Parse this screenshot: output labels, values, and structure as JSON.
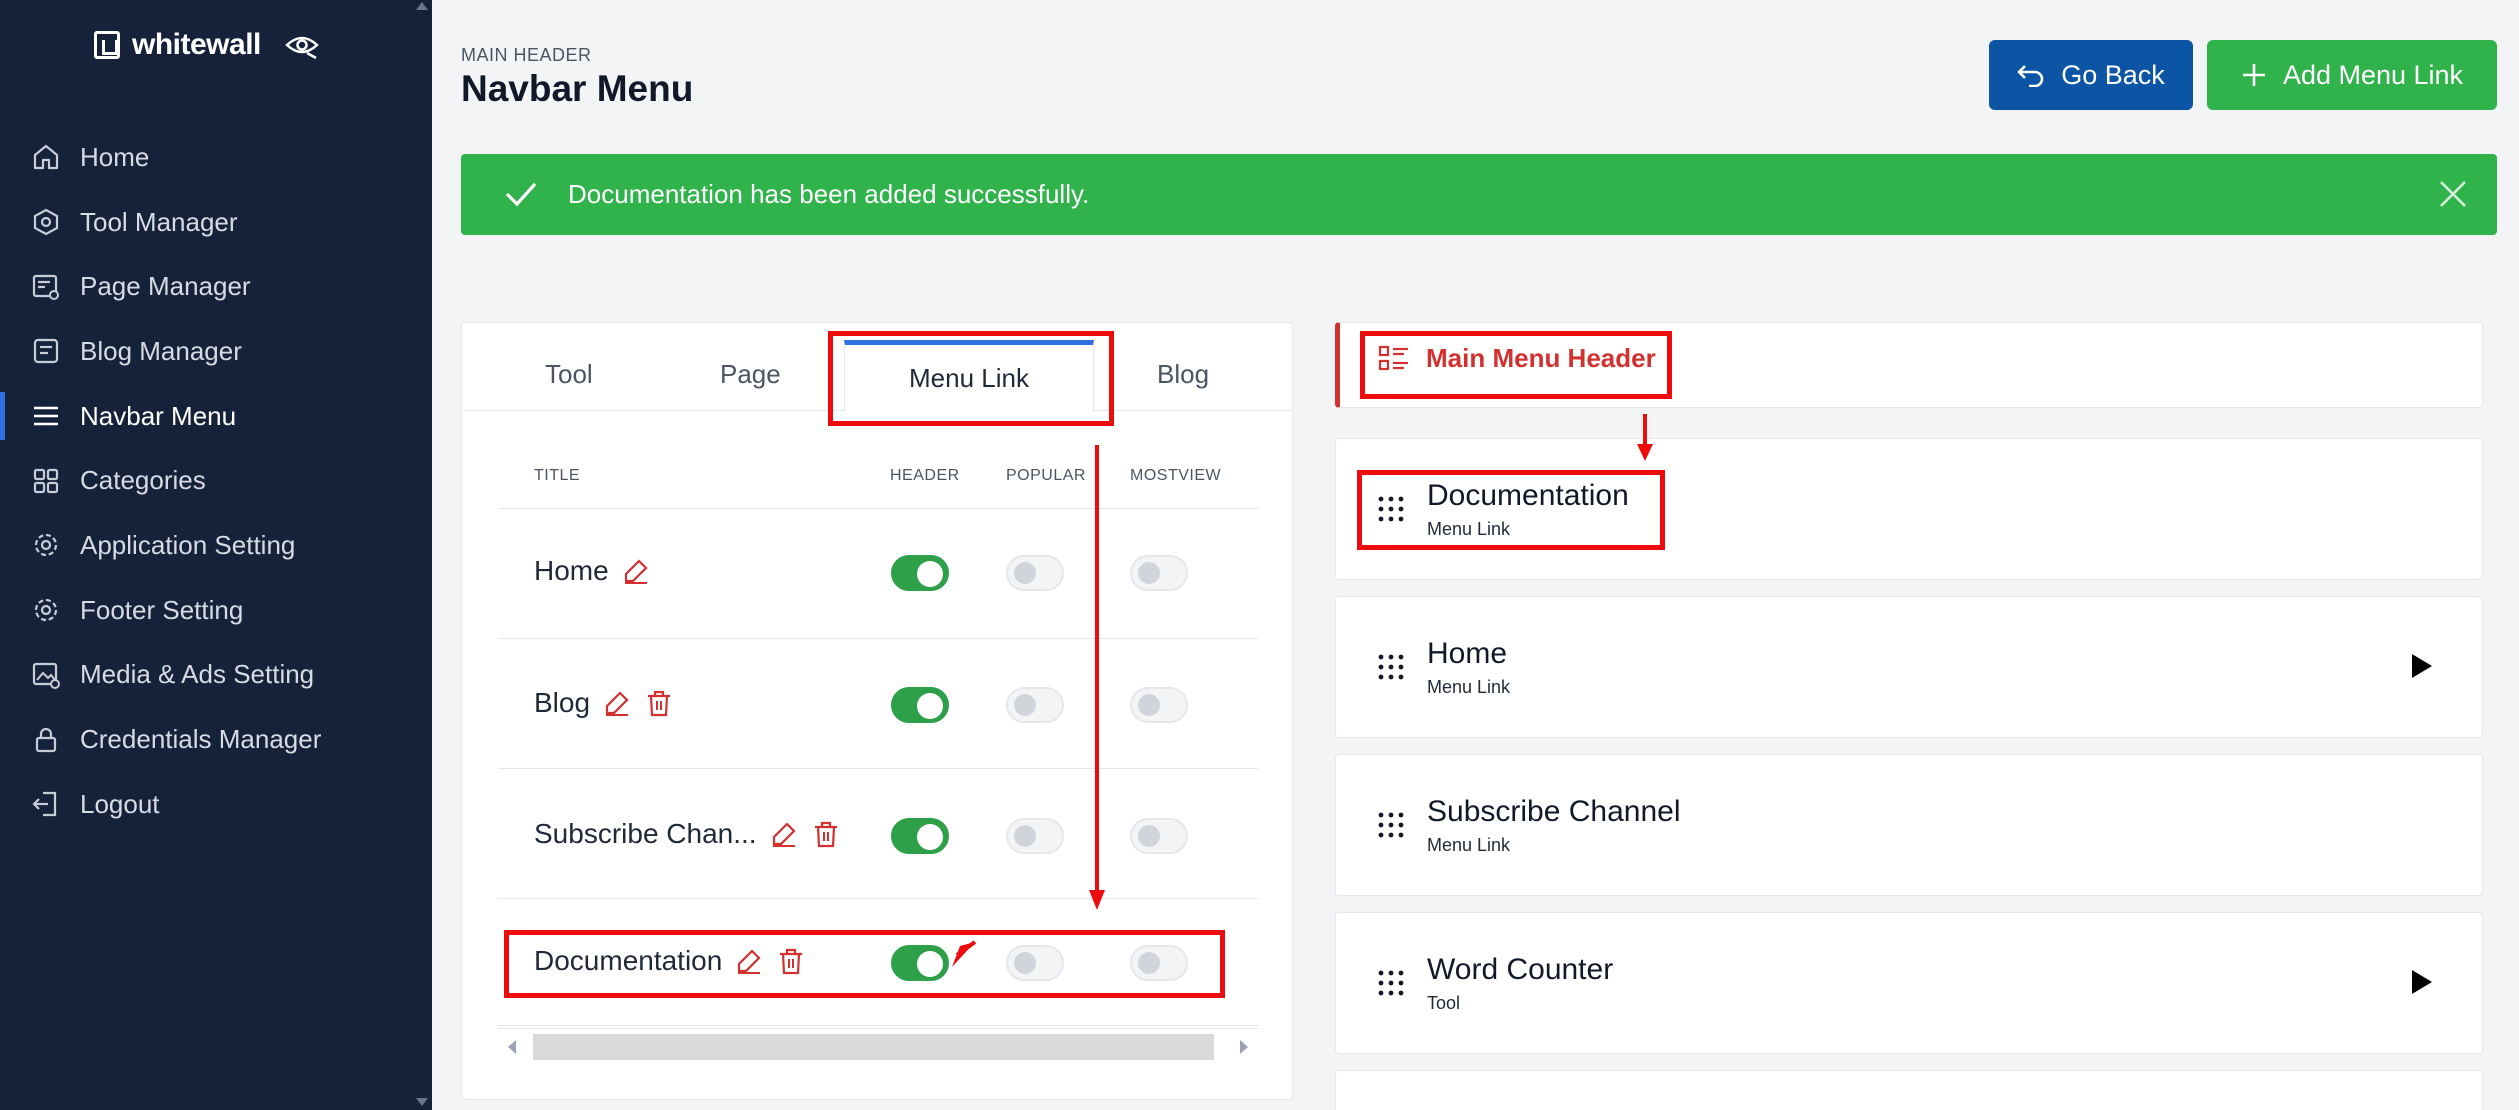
{
  "brand": {
    "name": "whitewall"
  },
  "sidebar": {
    "items": [
      {
        "label": "Home",
        "icon": "home-icon"
      },
      {
        "label": "Tool Manager",
        "icon": "hexagon-icon"
      },
      {
        "label": "Page Manager",
        "icon": "page-settings-icon"
      },
      {
        "label": "Blog Manager",
        "icon": "blog-icon"
      },
      {
        "label": "Navbar Menu",
        "icon": "menu-icon"
      },
      {
        "label": "Categories",
        "icon": "grid-icon"
      },
      {
        "label": "Application Setting",
        "icon": "gear-icon"
      },
      {
        "label": "Footer Setting",
        "icon": "gear-icon"
      },
      {
        "label": "Media & Ads Setting",
        "icon": "image-settings-icon"
      },
      {
        "label": "Credentials Manager",
        "icon": "lock-icon"
      },
      {
        "label": "Logout",
        "icon": "logout-icon"
      }
    ],
    "active": "Navbar Menu"
  },
  "header": {
    "eyebrow": "MAIN HEADER",
    "title": "Navbar Menu",
    "back_label": "Go Back",
    "add_label": "Add Menu Link"
  },
  "alert": {
    "message": "Documentation has been added successfully."
  },
  "tabs": [
    {
      "label": "Tool"
    },
    {
      "label": "Page"
    },
    {
      "label": "Menu Link"
    },
    {
      "label": "Blog"
    }
  ],
  "table": {
    "columns": [
      "TITLE",
      "HEADER",
      "POPULAR",
      "MOSTVIEW"
    ],
    "rows": [
      {
        "title": "Home",
        "header": true,
        "popular": false,
        "mostview": false,
        "deletable": false
      },
      {
        "title": "Blog",
        "header": true,
        "popular": false,
        "mostview": false,
        "deletable": true
      },
      {
        "title": "Subscribe Chan...",
        "header": true,
        "popular": false,
        "mostview": false,
        "deletable": true
      },
      {
        "title": "Documentation",
        "header": true,
        "popular": false,
        "mostview": false,
        "deletable": true
      }
    ]
  },
  "menu": {
    "header_label": "Main Menu Header",
    "items": [
      {
        "title": "Documentation",
        "type": "Menu Link"
      },
      {
        "title": "Home",
        "type": "Menu Link"
      },
      {
        "title": "Subscribe Channel",
        "type": "Menu Link"
      },
      {
        "title": "Word Counter",
        "type": "Tool"
      }
    ]
  },
  "colors": {
    "sidebar": "#15223a",
    "success": "#2fb34a",
    "primary": "#0b55a4",
    "accent": "#2f6fde",
    "danger": "#d33030",
    "annotation": "#ee0b0b"
  }
}
